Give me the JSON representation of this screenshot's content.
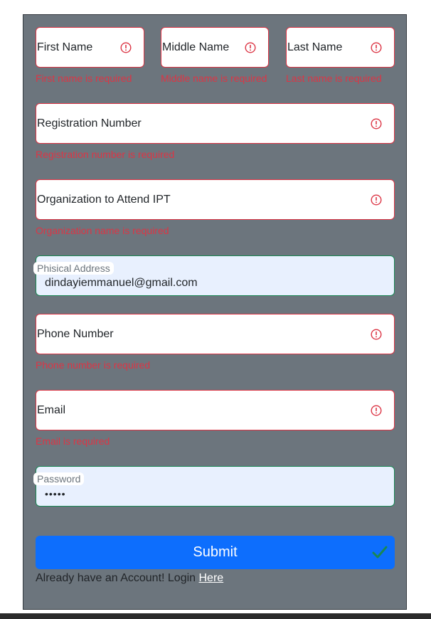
{
  "form": {
    "first_name": {
      "label": "First Name",
      "error": "First name is required"
    },
    "middle_name": {
      "label": "Middle Name",
      "error": "Middle name is required"
    },
    "last_name": {
      "label": "Last Name",
      "error": "Last name is required"
    },
    "registration_number": {
      "label": "Registration Number",
      "error": "Registration number is required"
    },
    "organization": {
      "label": "Organization to Attend IPT",
      "error": "Organization name is required"
    },
    "physical_address": {
      "label": "Phisical Address",
      "value": "dindayiemmanuel@gmail.com"
    },
    "phone_number": {
      "label": "Phone Number",
      "error": "Phone number is required"
    },
    "email": {
      "label": "Email",
      "error": "Email is required"
    },
    "password": {
      "label": "Password",
      "value": "•••••"
    },
    "submit_label": "Submit",
    "login_prompt": "Already have an Account! Login",
    "login_link": "Here"
  },
  "colors": {
    "panel": "#6c757d",
    "error": "#dc3545",
    "valid": "#198754",
    "autofill": "#e8f0fe",
    "primary": "#0d6efd"
  },
  "icons": {
    "error": "exclamation-circle-icon",
    "valid": "check-icon"
  }
}
